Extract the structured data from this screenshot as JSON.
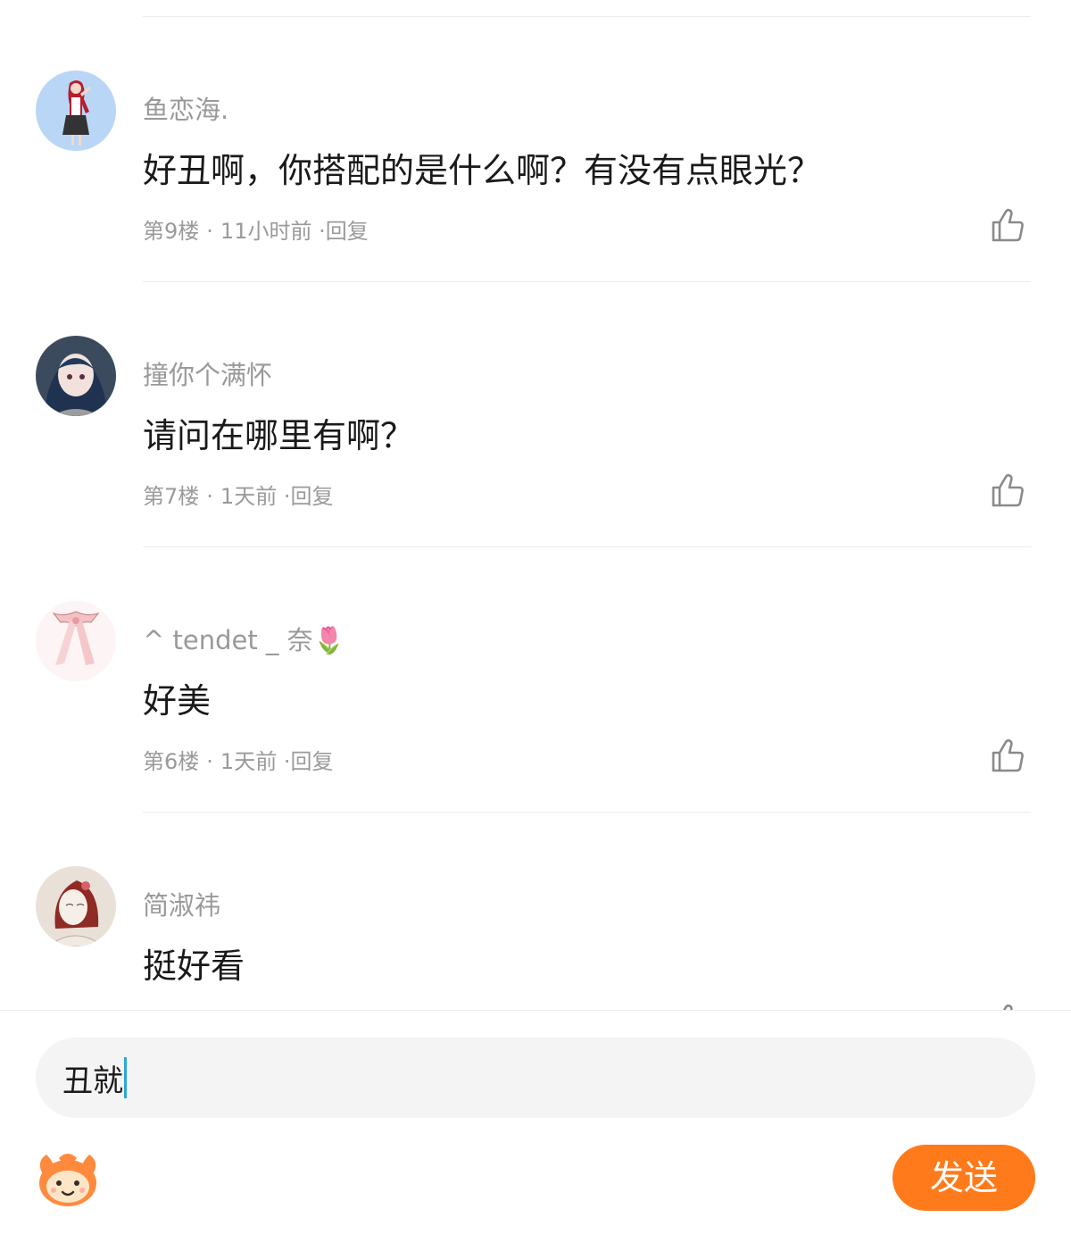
{
  "comments": [
    {
      "username": "鱼恋海.",
      "text": "好丑啊，你搭配的是什么啊？有没有点眼光？",
      "floor": "第9楼",
      "time": "11小时前",
      "reply_label": "·回复",
      "avatar_icon": "avatar-red-hair-girl-icon"
    },
    {
      "username": "撞你个满怀",
      "text": "请问在哪里有啊？",
      "floor": "第7楼",
      "time": "1天前",
      "reply_label": "·回复",
      "avatar_icon": "avatar-blue-hair-girl-icon"
    },
    {
      "username": "^ tendet _ 奈",
      "username_emoji": "🌷",
      "text": "好美",
      "floor": "第6楼",
      "time": "1天前",
      "reply_label": "·回复",
      "avatar_icon": "avatar-pink-bow-icon"
    },
    {
      "username": "简淑祎",
      "text": "挺好看",
      "avatar_icon": "avatar-sketch-girl-icon"
    }
  ],
  "meta_separator": "·",
  "input": {
    "value": "丑就"
  },
  "send_label": "发送",
  "icons": {
    "like": "thumbs-up-icon",
    "emoji": "emoji-face-icon"
  },
  "colors": {
    "send_button": "#ff7a1a",
    "username": "#999999",
    "meta": "#9a9a9a",
    "input_background": "#f4f4f4",
    "caret": "#29a8d6"
  }
}
